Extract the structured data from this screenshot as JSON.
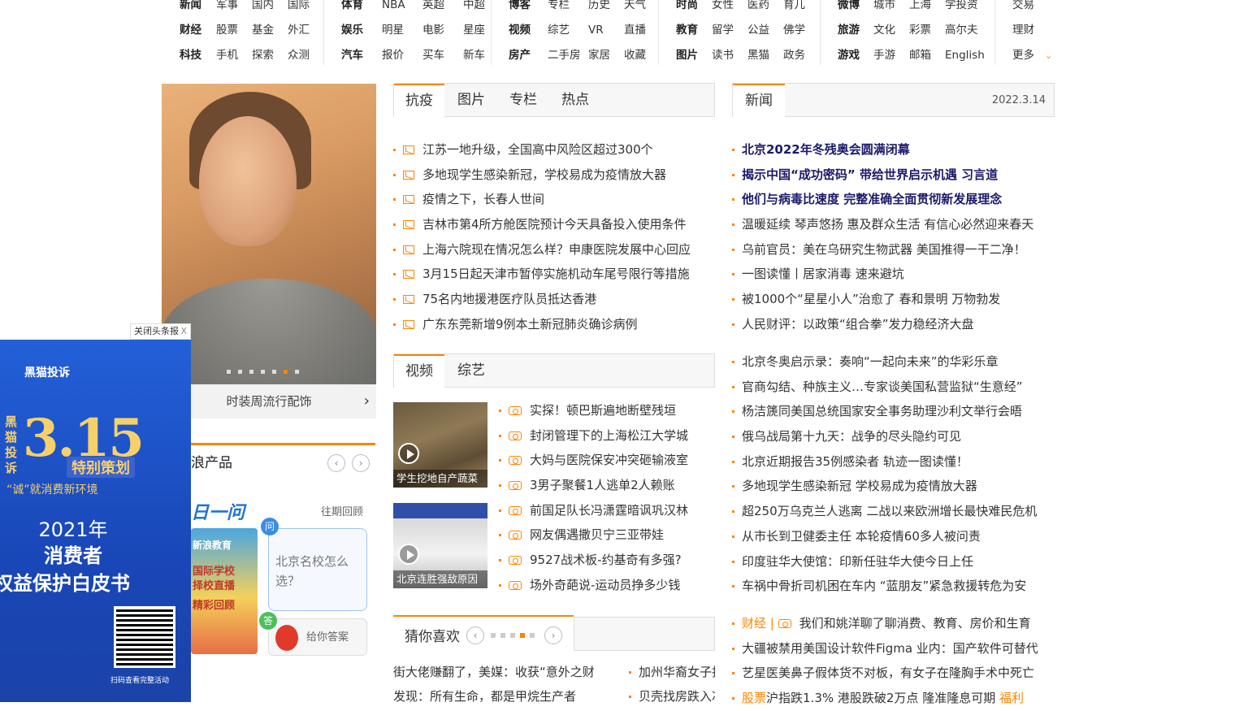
{
  "nav": {
    "columns": [
      {
        "rows": [
          [
            "新闻",
            "军事",
            "国内",
            "国际"
          ],
          [
            "财经",
            "股票",
            "基金",
            "外汇"
          ],
          [
            "科技",
            "手机",
            "探索",
            "众测"
          ]
        ]
      },
      {
        "rows": [
          [
            "体育",
            "NBA",
            "英超",
            "中超"
          ],
          [
            "娱乐",
            "明星",
            "电影",
            "星座"
          ],
          [
            "汽车",
            "报价",
            "买车",
            "新车"
          ]
        ]
      },
      {
        "rows": [
          [
            "博客",
            "专栏",
            "历史",
            "天气"
          ],
          [
            "视频",
            "综艺",
            "VR",
            "直播"
          ],
          [
            "房产",
            "二手房",
            "家居",
            "收藏"
          ]
        ]
      },
      {
        "rows": [
          [
            "时尚",
            "女性",
            "医药",
            "育儿"
          ],
          [
            "教育",
            "留学",
            "公益",
            "佛学"
          ],
          [
            "图片",
            "读书",
            "黑猫",
            "政务"
          ]
        ]
      },
      {
        "rows": [
          [
            "微博",
            "城市",
            "上海",
            "学投资"
          ],
          [
            "旅游",
            "文化",
            "彩票",
            "高尔夫"
          ],
          [
            "游戏",
            "手游",
            "邮箱",
            "English"
          ]
        ]
      },
      {
        "rows": [
          [
            "交易"
          ],
          [
            "理财"
          ],
          [
            "更多"
          ]
        ]
      }
    ]
  },
  "slider": {
    "caption": "时装周流行配饰",
    "arrow": "›"
  },
  "product": {
    "title": "浪产品",
    "brand": "日一问",
    "past_label": "往期回顾",
    "thumb_lines": [
      "新浪教育",
      "国际学校",
      "择校直播",
      "精彩回顾"
    ],
    "question_badge": "问",
    "question": "北京名校怎么选？",
    "answer_badge": "答",
    "answer_cta": "给你答案"
  },
  "ad": {
    "close_label": "关闭头条报",
    "close_x": "X",
    "logo": "黑猫投诉",
    "vertical_text": "黑猫投诉",
    "big": "3.15",
    "special": "特别策划",
    "slogan": "“诚”就消费新环境",
    "line1": "2021年",
    "line2": "消费者",
    "line3": "权益保护白皮书",
    "qr_caption": "扫码查看完整活动"
  },
  "tabs1": {
    "items": [
      "抗疫",
      "图片",
      "专栏",
      "热点"
    ]
  },
  "tabs2": {
    "items": [
      "新闻"
    ],
    "date": "2022.3.14"
  },
  "tabs3": {
    "items": [
      "视频",
      "综艺"
    ]
  },
  "list1": [
    "江苏一地升级，全国高中风险区超过300个",
    "多地现学生感染新冠，学校易成为疫情放大器",
    "疫情之下，长春人世间",
    "吉林市第4所方舱医院预计今天具备投入使用条件",
    "上海六院现在情况怎么样？申康医院发展中心回应",
    "3月15日起天津市暂停实施机动车尾号限行等措施",
    "75名内地援港医疗队员抵达香港",
    "广东东莞新增9例本土新冠肺炎确诊病例"
  ],
  "news_bold": [
    "北京2022年冬残奥会圆满闭幕",
    "揭示中国“成功密码” 带给世界启示机遇 习言道",
    "他们与病毒比速度 完整准确全面贯彻新发展理念"
  ],
  "news_a": [
    "温暖延续 琴声悠扬 惠及群众生活 有信心必然迎来春天",
    "乌前官员：美在乌研究生物武器 美国推得一干二净！",
    "一图读懂丨居家消毒 速来避坑",
    "被1000个“星星小人”治愈了 春和景明 万物勃发",
    "人民财评：以政策“组合拳”发力稳经济大盘"
  ],
  "news_b": [
    "北京冬奥启示录：奏响“一起向未来”的华彩乐章",
    "官商勾结、种族主义…专家谈美国私营监狱“生意经”",
    "杨洁篪同美国总统国家安全事务助理沙利文举行会晤",
    "俄乌战局第十九天：战争的尽头隐约可见",
    "北京近期报告35例感染者 轨迹一图读懂！",
    "多地现学生感染新冠 学校易成为疫情放大器",
    "超250万乌克兰人逃离 二战以来欧洲增长最快难民危机",
    "从市长到卫健委主任 本轮疫情60多人被问责",
    "印度驻华大使馆：印新任驻华大使今日上任",
    "车祸中骨折司机困在车内 “蓝朋友”紧急救援转危为安"
  ],
  "news_c": {
    "tag": "财经 |",
    "first": "我们和姚洋聊了聊消费、教育、房价和生育",
    "items": [
      "大疆被禁用美国设计软件Figma 业内：国产软件可替代",
      "艺星医美鼻子假体货不对板，有女子在隆胸手术中死亡"
    ],
    "last_tag": "股票",
    "last": "沪指跌1.3% 港股跌破2万点 隆准隆息可期",
    "last_tag2": "福利"
  },
  "videos": [
    {
      "caption": "学生挖地自产蔬菜"
    },
    {
      "caption": "北京连胜强敌原因"
    }
  ],
  "video_list": [
    "实探！顿巴斯遍地断壁残垣",
    "封闭管理下的上海松江大学城",
    "大妈与医院保安冲突砸输液室",
    "3男子聚餐1人逃单2人赖账",
    "前国足队长冯潇霆暗讽巩汉林",
    "网友偶遇撒贝宁三亚带娃",
    "9527战术板-约基奇有多强?",
    "场外奇葩说-运动员挣多少钱"
  ],
  "guess": {
    "title": "猜你喜欢",
    "prev": "‹",
    "next": "›",
    "col1": [
      "街大佬赚翻了，美媒：收获“意外之财",
      "发现：所有生命，都是甲烷生产者"
    ],
    "col2": [
      "加州华裔女子拒",
      "贝壳找房跌入冰"
    ]
  },
  "colors": {
    "accent": "#ff8400",
    "bold_news": "#1a1a6a",
    "ad_blue": "#1f50c8"
  }
}
